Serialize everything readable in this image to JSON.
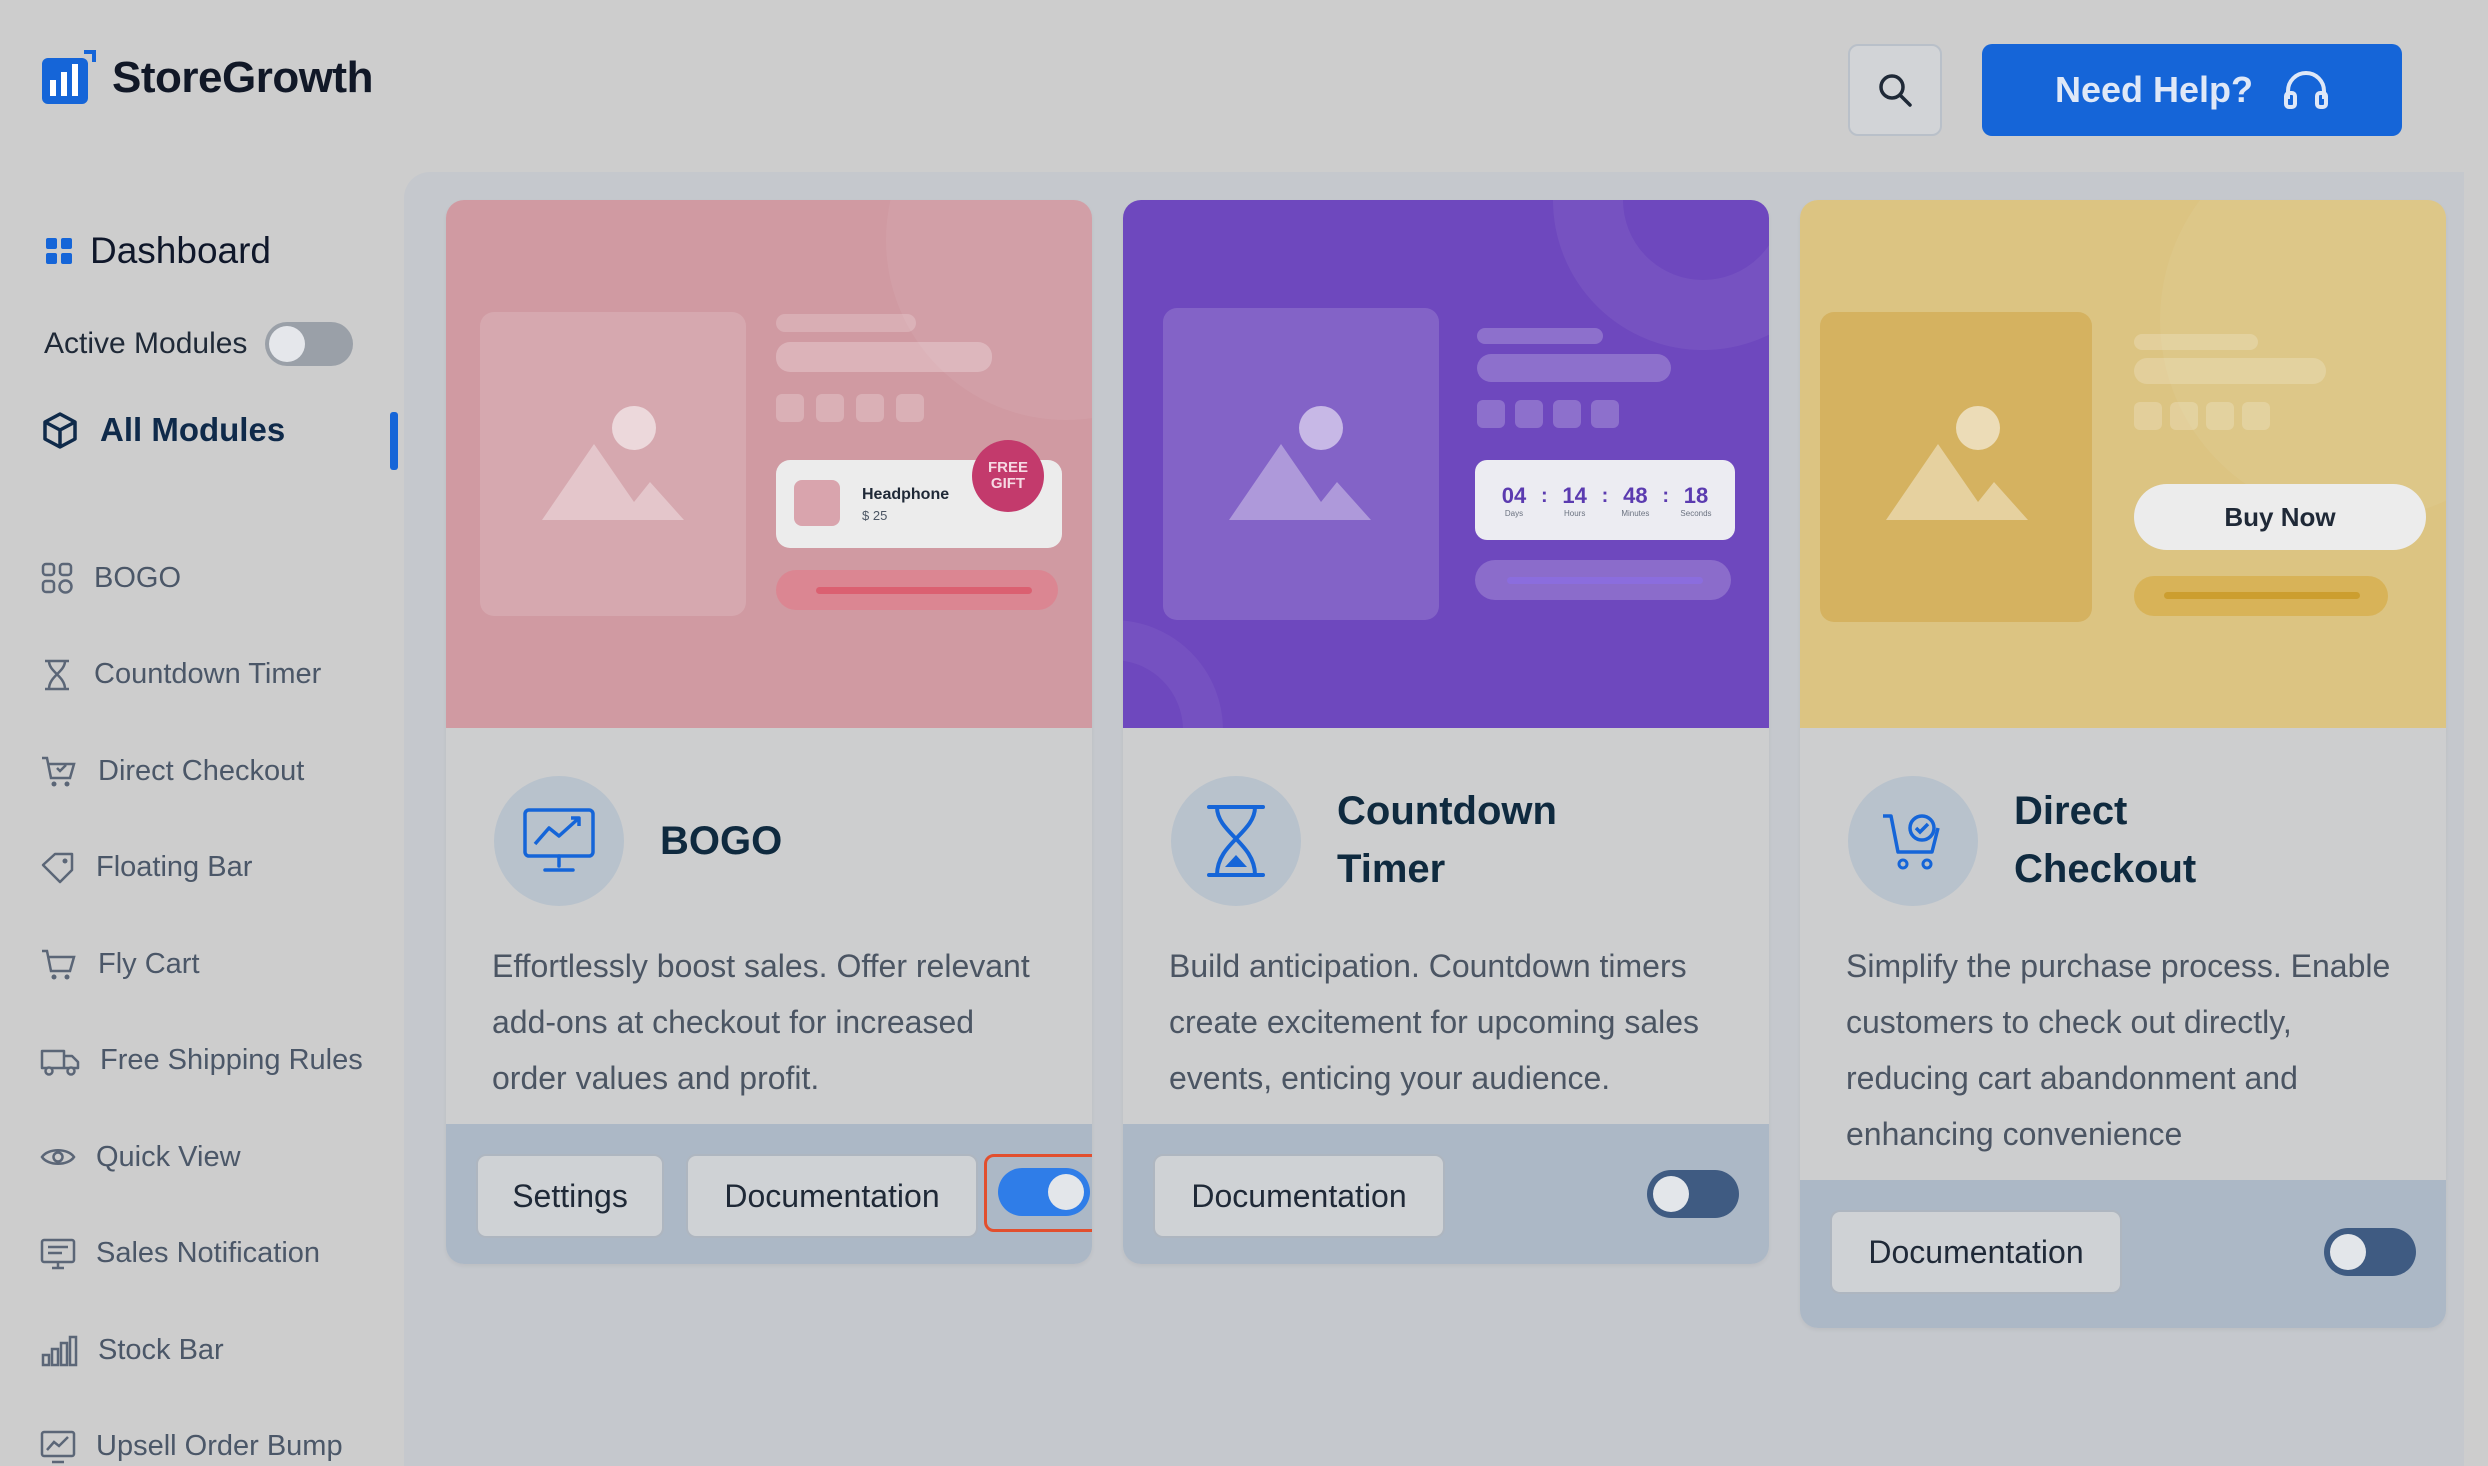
{
  "header": {
    "logo_text": "StoreGrowth",
    "help_label": "Need Help?"
  },
  "sidebar": {
    "dashboard_label": "Dashboard",
    "active_modules_label": "Active Modules",
    "active_modules_on": false,
    "all_modules_label": "All Modules",
    "items": [
      {
        "label": "BOGO",
        "icon": "bogo-icon"
      },
      {
        "label": "Countdown Timer",
        "icon": "hourglass-icon"
      },
      {
        "label": "Direct Checkout",
        "icon": "cart-check-icon"
      },
      {
        "label": "Floating Bar",
        "icon": "tag-icon"
      },
      {
        "label": "Fly Cart",
        "icon": "cart-icon"
      },
      {
        "label": "Free Shipping Rules",
        "icon": "truck-icon"
      },
      {
        "label": "Quick View",
        "icon": "eye-icon"
      },
      {
        "label": "Sales Notification",
        "icon": "notification-icon"
      },
      {
        "label": "Stock Bar",
        "icon": "stock-bar-icon"
      },
      {
        "label": "Upsell Order Bump",
        "icon": "chart-icon"
      }
    ]
  },
  "cards": [
    {
      "title": "BOGO",
      "description": "Effortlessly boost sales. Offer relevant add-ons at checkout for increased order values and profit.",
      "settings_label": "Settings",
      "doc_label": "Documentation",
      "enabled": true,
      "hero": {
        "product_name": "Headphone",
        "product_price": "$ 25",
        "badge_line1": "FREE",
        "badge_line2": "GIFT"
      }
    },
    {
      "title": "Countdown Timer",
      "title_line1": "Countdown",
      "title_line2": "Timer",
      "description": "Build anticipation. Countdown timers create excitement for upcoming sales events, enticing your audience.",
      "doc_label": "Documentation",
      "enabled": false,
      "hero": {
        "timer": [
          {
            "value": "04",
            "unit": "Days"
          },
          {
            "value": "14",
            "unit": "Hours"
          },
          {
            "value": "48",
            "unit": "Minutes"
          },
          {
            "value": "18",
            "unit": "Seconds"
          }
        ],
        "sep": ":"
      }
    },
    {
      "title": "Direct Checkout",
      "title_line1": "Direct",
      "title_line2": "Checkout",
      "description": "Simplify the purchase process. Enable customers to check out directly, reducing cart abandonment and enhancing convenience",
      "doc_label": "Documentation",
      "enabled": false,
      "hero": {
        "buy_label": "Buy Now"
      }
    }
  ],
  "colors": {
    "brand": "#1565d8",
    "bogo_hero": "#d09aa2",
    "timer_hero": "#6e48be",
    "checkout_hero": "#dcc482"
  }
}
